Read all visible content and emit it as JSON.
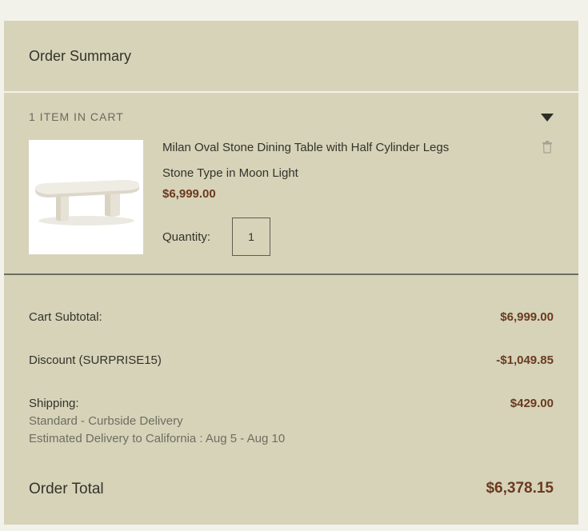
{
  "order_summary": {
    "title": "Order Summary",
    "cart_count_label": "1 ITEM IN CART",
    "item": {
      "name": "Milan Oval Stone Dining Table with Half Cylinder Legs",
      "variant": "Stone Type in Moon Light",
      "price": "$6,999.00",
      "quantity_label": "Quantity:",
      "quantity": "1",
      "image": "oval-stone-table-image"
    },
    "subtotal_label": "Cart Subtotal:",
    "subtotal_value": "$6,999.00",
    "discount_label": "Discount (SURPRISE15)",
    "discount_value": "-$1,049.85",
    "shipping_label": "Shipping:",
    "shipping_value": "$429.00",
    "shipping_method": "Standard - Curbside Delivery",
    "shipping_estimate": "Estimated Delivery to California : Aug 5 - Aug 10",
    "total_label": "Order Total",
    "total_value": "$6,378.15"
  },
  "icons": {
    "caret": "caret-down-icon",
    "trash": "trash-icon"
  },
  "colors": {
    "panel_bg": "#d6d3b9",
    "page_bg": "#f2f1ea",
    "price_accent": "#6b3a1f"
  }
}
